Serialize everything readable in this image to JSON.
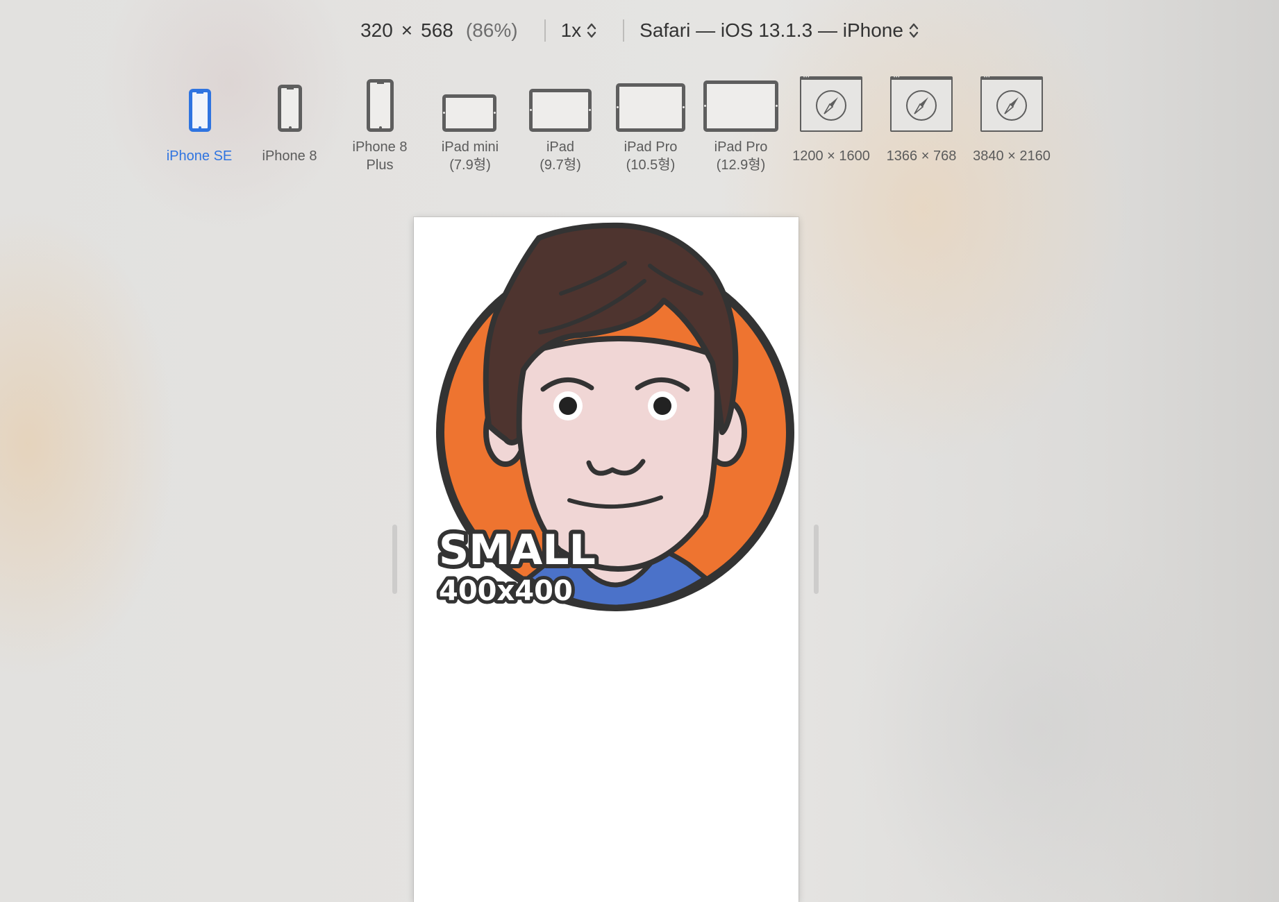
{
  "toolbar": {
    "width": "320",
    "times": "×",
    "height": "568",
    "percent": "(86%)",
    "scale": "1x",
    "user_agent": "Safari — iOS 13.1.3 — iPhone"
  },
  "devices": [
    {
      "name": "iPhone SE",
      "selected": true
    },
    {
      "name": "iPhone 8",
      "selected": false
    },
    {
      "name": "iPhone 8",
      "name_line2": "Plus",
      "selected": false
    },
    {
      "name": "iPad mini",
      "name_line2": "(7.9형)",
      "selected": false
    },
    {
      "name": "iPad",
      "name_line2": "(9.7형)",
      "selected": false
    },
    {
      "name": "iPad Pro",
      "name_line2": "(10.5형)",
      "selected": false
    },
    {
      "name": "iPad Pro",
      "name_line2": "(12.9형)",
      "selected": false
    },
    {
      "name": "1200 × 1600",
      "selected": false
    },
    {
      "name": "1366 × 768",
      "selected": false
    },
    {
      "name": "3840 × 2160",
      "selected": false
    }
  ],
  "viewport_image": {
    "badge_line1": "SMALL",
    "badge_line2": "400x400"
  },
  "colors": {
    "accent": "#2f74e0",
    "icon_gray": "#5e5e5e",
    "avatar_ring": "#ee7430",
    "avatar_hair": "#4e342f",
    "avatar_skin": "#f0d6d5",
    "avatar_shirt": "#4b72c9",
    "avatar_outline": "#333333"
  }
}
